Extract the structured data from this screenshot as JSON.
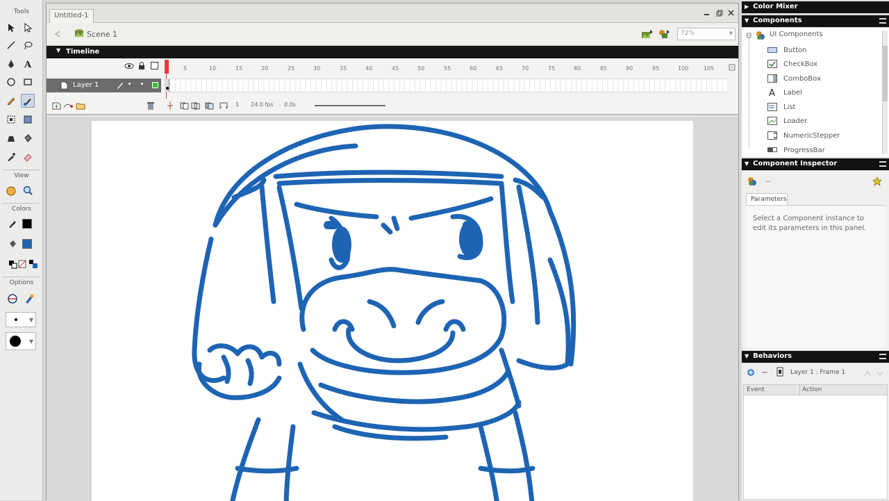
{
  "tools_panel": {
    "title": "Tools",
    "view_title": "View",
    "colors_title": "Colors",
    "options_title": "Options",
    "stroke_color": "#000000",
    "fill_color": "#1e64b4"
  },
  "document": {
    "tab_title": "Untitled-1",
    "scene_label": "Scene 1",
    "zoom_value": "72%"
  },
  "timeline": {
    "title": "Timeline",
    "layer_name": "Layer 1",
    "frame_numbers": [
      "5",
      "10",
      "15",
      "20",
      "25",
      "30",
      "35",
      "40",
      "45",
      "50",
      "55",
      "60",
      "65",
      "70",
      "75",
      "80",
      "85",
      "90",
      "95",
      "100",
      "105"
    ],
    "current_frame": "1",
    "frame_rate": "24.0 fps",
    "elapsed_time": "0.0s"
  },
  "panels": {
    "color_mixer_title": "Color Mixer",
    "components_title": "Components",
    "components_group": "UI Components",
    "components": [
      "Button",
      "CheckBox",
      "ComboBox",
      "Label",
      "List",
      "Loader",
      "NumericStepper",
      "ProgressBar"
    ],
    "inspector_title": "Component Inspector",
    "inspector_dash": "--",
    "inspector_tab": "Parameters",
    "inspector_message": "Select a Component instance to edit its parameters in this panel.",
    "behaviors_title": "Behaviors",
    "behaviors_target": "Layer 1 : Frame 1",
    "behaviors_columns": [
      "Event",
      "Action"
    ]
  },
  "colors": {
    "ink": "#1e64b4",
    "panel_header": "#121212",
    "playhead": "#e23b3b"
  }
}
